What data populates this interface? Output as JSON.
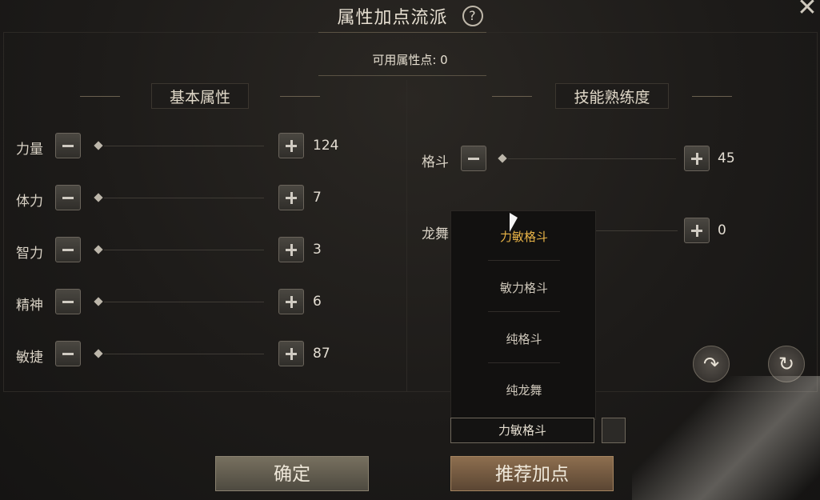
{
  "header": {
    "title": "属性加点流派",
    "help_icon": "question-icon",
    "close_icon": "close-icon"
  },
  "available_points": {
    "text": "可用属性点: 0"
  },
  "basic": {
    "title": "基本属性",
    "rows": [
      {
        "label": "力量",
        "value": "124"
      },
      {
        "label": "体力",
        "value": "7"
      },
      {
        "label": "智力",
        "value": "3"
      },
      {
        "label": "精神",
        "value": "6"
      },
      {
        "label": "敏捷",
        "value": "87"
      }
    ]
  },
  "skills": {
    "title": "技能熟练度",
    "rows": [
      {
        "label": "格斗",
        "value": "45"
      },
      {
        "label": "龙舞",
        "value": "0"
      }
    ]
  },
  "dropdown": {
    "options": [
      "力敏格斗",
      "敏力格斗",
      "纯格斗",
      "纯龙舞"
    ],
    "selected": "力敏格斗"
  },
  "buttons": {
    "confirm": "确定",
    "recommend": "推荐加点"
  },
  "colors": {
    "accent": "#e9b447",
    "panel": "#1c1a18"
  }
}
